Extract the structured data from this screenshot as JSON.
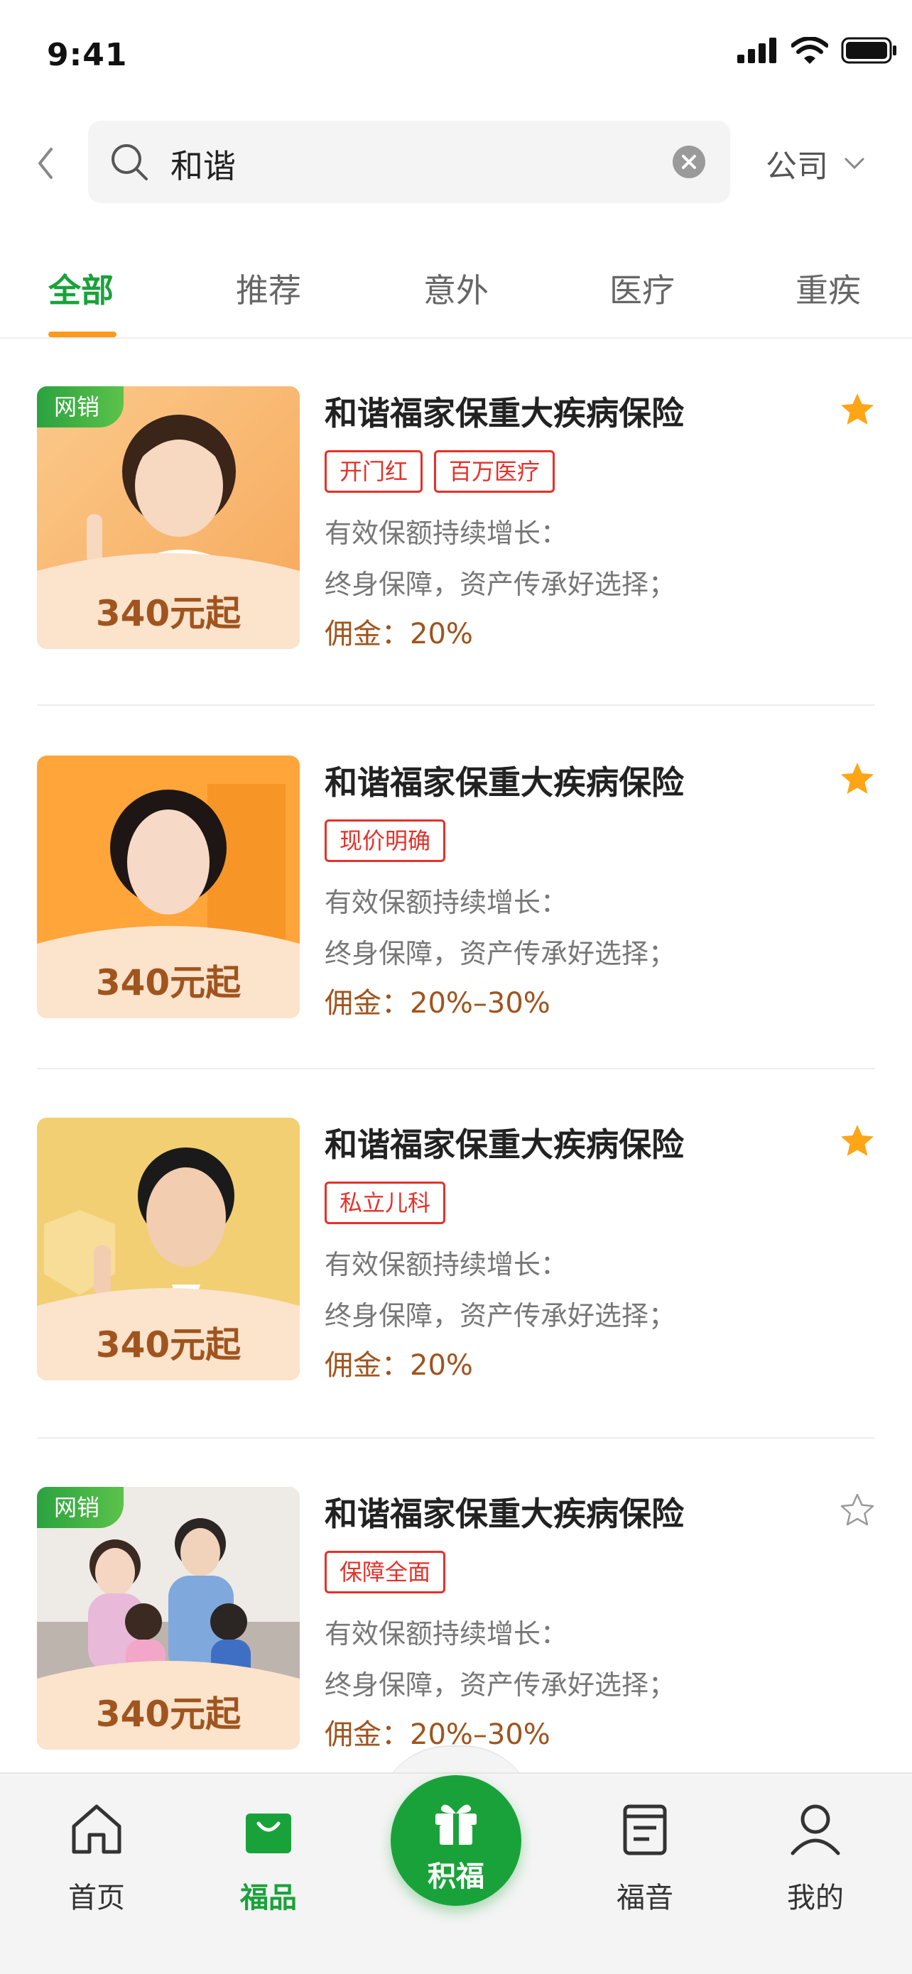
{
  "status_bar": {
    "time": "9:41"
  },
  "search": {
    "value": "和谐",
    "scope_label": "公司"
  },
  "tabs": [
    {
      "label": "全部",
      "active": true
    },
    {
      "label": "推荐",
      "active": false
    },
    {
      "label": "意外",
      "active": false
    },
    {
      "label": "医疗",
      "active": false
    },
    {
      "label": "重疾",
      "active": false
    }
  ],
  "products": [
    {
      "badge": "网销",
      "price": "340元起",
      "title": "和谐福家保重大疾病保险",
      "tags": [
        "开门红",
        "百万医疗"
      ],
      "line1": "有效保额持续增长：",
      "line2": "终身保障，资产传承好选择；",
      "commission": "佣金：20%",
      "favorited": true
    },
    {
      "badge": "",
      "price": "340元起",
      "title": "和谐福家保重大疾病保险",
      "tags": [
        "现价明确"
      ],
      "line1": "有效保额持续增长：",
      "line2": "终身保障，资产传承好选择；",
      "commission": "佣金：20%–30%",
      "favorited": true
    },
    {
      "badge": "",
      "price": "340元起",
      "title": "和谐福家保重大疾病保险",
      "tags": [
        "私立儿科"
      ],
      "line1": "有效保额持续增长：",
      "line2": "终身保障，资产传承好选择；",
      "commission": "佣金：20%",
      "favorited": true
    },
    {
      "badge": "网销",
      "price": "340元起",
      "title": "和谐福家保重大疾病保险",
      "tags": [
        "保障全面"
      ],
      "line1": "有效保额持续增长：",
      "line2": "终身保障，资产传承好选择；",
      "commission": "佣金：20%–30%",
      "favorited": false
    }
  ],
  "tabbar": {
    "home": "首页",
    "products": "福品",
    "center": "积福",
    "news": "福音",
    "mine": "我的"
  },
  "colors": {
    "brand_green": "#1aa23a",
    "accent_orange": "#ff9a1a",
    "tag_red": "#e4312a",
    "price_brown": "#a0541e"
  }
}
